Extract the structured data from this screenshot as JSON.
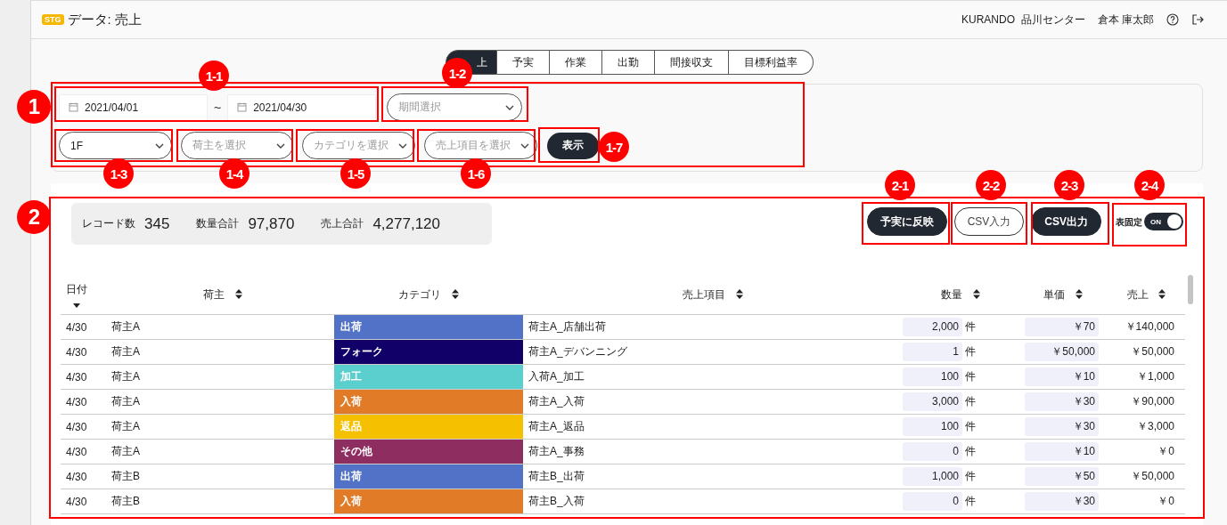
{
  "header": {
    "env_badge": "STG",
    "title": "データ: 売上",
    "organization": "KURANDO  品川センター",
    "user": "倉本 庫太郎"
  },
  "tabs": [
    {
      "label": "上",
      "selected": true
    },
    {
      "label": "予実",
      "selected": false
    },
    {
      "label": "作業",
      "selected": false
    },
    {
      "label": "出勤",
      "selected": false
    },
    {
      "label": "間接収支",
      "selected": false
    },
    {
      "label": "目標利益率",
      "selected": false
    }
  ],
  "filters": {
    "date_from": "2021/04/01",
    "separator": "~",
    "date_to": "2021/04/30",
    "period": {
      "placeholder": "期間選択"
    },
    "selects": [
      {
        "value": "1F"
      },
      {
        "placeholder": "荷主を選択"
      },
      {
        "placeholder": "カテゴリを選択"
      },
      {
        "placeholder": "売上項目を選択"
      }
    ],
    "show_button": "表示"
  },
  "summary": [
    {
      "label": "レコード数",
      "value": "345"
    },
    {
      "label": "数量合計",
      "value": "97,870"
    },
    {
      "label": "売上合計",
      "value": "4,277,120"
    }
  ],
  "actions": [
    {
      "label": "予実に反映",
      "kind": "solid"
    },
    {
      "label": "CSV入力",
      "kind": "outline"
    },
    {
      "label": "CSV出力",
      "kind": "solid"
    }
  ],
  "fix_table": {
    "label": "表固定",
    "toggle": "ON",
    "on": true
  },
  "table": {
    "columns": [
      {
        "label": "日付",
        "kind": "sorted"
      },
      {
        "label": "荷主",
        "kind": "sortable"
      },
      {
        "label": "カテゴリ",
        "kind": "sortable"
      },
      {
        "label": "売上項目",
        "kind": "sortable"
      },
      {
        "label": "数量",
        "kind": "sortable"
      },
      {
        "label": "単価",
        "kind": "sortable"
      },
      {
        "label": "売上",
        "kind": "sortable"
      }
    ],
    "rows": [
      {
        "date": "4/30",
        "shipper": "荷主A",
        "category": "出荷",
        "color": "#5272c8",
        "item": "荷主A_店舗出荷",
        "qty": "2,000",
        "unit": "件",
        "unit_price": "￥70",
        "sales": "￥140,000"
      },
      {
        "date": "4/30",
        "shipper": "荷主A",
        "category": "フォーク",
        "color": "#100068",
        "item": "荷主A_デバンニング",
        "qty": "1",
        "unit": "件",
        "unit_price": "￥50,000",
        "sales": "￥50,000"
      },
      {
        "date": "4/30",
        "shipper": "荷主A",
        "category": "加工",
        "color": "#5bcfcd",
        "item": "入荷A_加工",
        "qty": "100",
        "unit": "件",
        "unit_price": "￥10",
        "sales": "￥1,000"
      },
      {
        "date": "4/30",
        "shipper": "荷主A",
        "category": "入荷",
        "color": "#e27b28",
        "item": "荷主A_入荷",
        "qty": "3,000",
        "unit": "件",
        "unit_price": "￥30",
        "sales": "￥90,000"
      },
      {
        "date": "4/30",
        "shipper": "荷主A",
        "category": "返品",
        "color": "#f5c000",
        "item": "荷主A_返品",
        "qty": "100",
        "unit": "件",
        "unit_price": "￥30",
        "sales": "￥3,000"
      },
      {
        "date": "4/30",
        "shipper": "荷主A",
        "category": "その他",
        "color": "#8e2d60",
        "item": "荷主A_事務",
        "qty": "0",
        "unit": "件",
        "unit_price": "￥10",
        "sales": "￥0"
      },
      {
        "date": "4/30",
        "shipper": "荷主B",
        "category": "出荷",
        "color": "#5272c8",
        "item": "荷主B_出荷",
        "qty": "1,000",
        "unit": "件",
        "unit_price": "￥50",
        "sales": "￥50,000"
      },
      {
        "date": "4/30",
        "shipper": "荷主B",
        "category": "入荷",
        "color": "#e27b28",
        "item": "荷主B_入荷",
        "qty": "0",
        "unit": "件",
        "unit_price": "￥30",
        "sales": "￥0"
      }
    ]
  },
  "annotations": [
    {
      "label": "1",
      "kind": "group"
    },
    {
      "label": "1-1",
      "kind": "item"
    },
    {
      "label": "1-2",
      "kind": "item"
    },
    {
      "label": "1-3",
      "kind": "item"
    },
    {
      "label": "1-4",
      "kind": "item"
    },
    {
      "label": "1-5",
      "kind": "item"
    },
    {
      "label": "1-6",
      "kind": "item"
    },
    {
      "label": "1-7",
      "kind": "item"
    },
    {
      "label": "2",
      "kind": "group"
    },
    {
      "label": "2-1",
      "kind": "item"
    },
    {
      "label": "2-2",
      "kind": "item"
    },
    {
      "label": "2-3",
      "kind": "item"
    },
    {
      "label": "2-4",
      "kind": "item"
    }
  ]
}
